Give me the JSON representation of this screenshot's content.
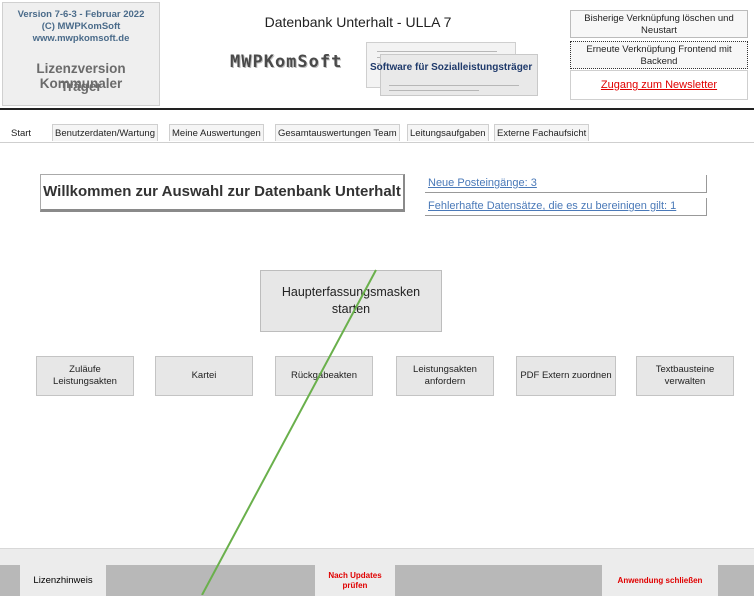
{
  "header": {
    "version": "Version 7-6-3 - Februar 2022",
    "copyright": "(C) MWPKomSoft",
    "website": "www.mwpkomsoft.de",
    "license_line1": "Lizenzversion Kommunaler",
    "license_line2": "Träger",
    "db_title": "Datenbank Unterhalt - ULLA 7",
    "logo_text": "MWPKomSoft",
    "logo_subtitle": "Software für Sozialleistungsträger",
    "btn_reset_link": "Bisherige Verknüpfung löschen und Neustart",
    "btn_relink_frontend": "Erneute Verknüpfung Frontend mit Backend",
    "newsletter_link": "Zugang zum Newsletter"
  },
  "tabs": [
    {
      "label": "Start"
    },
    {
      "label": "Benutzerdaten/Wartung"
    },
    {
      "label": "Meine Auswertungen"
    },
    {
      "label": "Gesamtauswertungen Team"
    },
    {
      "label": "Leitungsaufgaben"
    },
    {
      "label": "Externe Fachaufsicht"
    }
  ],
  "main": {
    "welcome": "Willkommen zur Auswahl zur Datenbank Unterhalt",
    "new_inbox": "Neue Posteingänge: 3",
    "faulty_records": "Fehlerhafte Datensätze, die es zu bereinigen gilt: 1",
    "main_button_line1": "Haupterfassungsmasken",
    "main_button_line2": "starten",
    "buttons": [
      {
        "line1": "Zuläufe",
        "line2": "Leistungsakten"
      },
      {
        "line1": "Kartei",
        "line2": ""
      },
      {
        "line1": "Rückgabeakten",
        "line2": ""
      },
      {
        "line1": "Leistungsakten",
        "line2": "anfordern"
      },
      {
        "line1": "PDF Extern zuordnen",
        "line2": ""
      },
      {
        "line1": "Textbausteine",
        "line2": "verwalten"
      }
    ]
  },
  "footer": {
    "license_notice": "Lizenzhinweis",
    "check_updates_line1": "Nach Updates",
    "check_updates_line2": "prüfen",
    "close_app": "Anwendung schließen"
  },
  "colors": {
    "accent_red": "#e00000",
    "link_blue": "#4a79b8",
    "header_blue": "#4a6b8a",
    "annotation_green": "#6ab04c"
  }
}
